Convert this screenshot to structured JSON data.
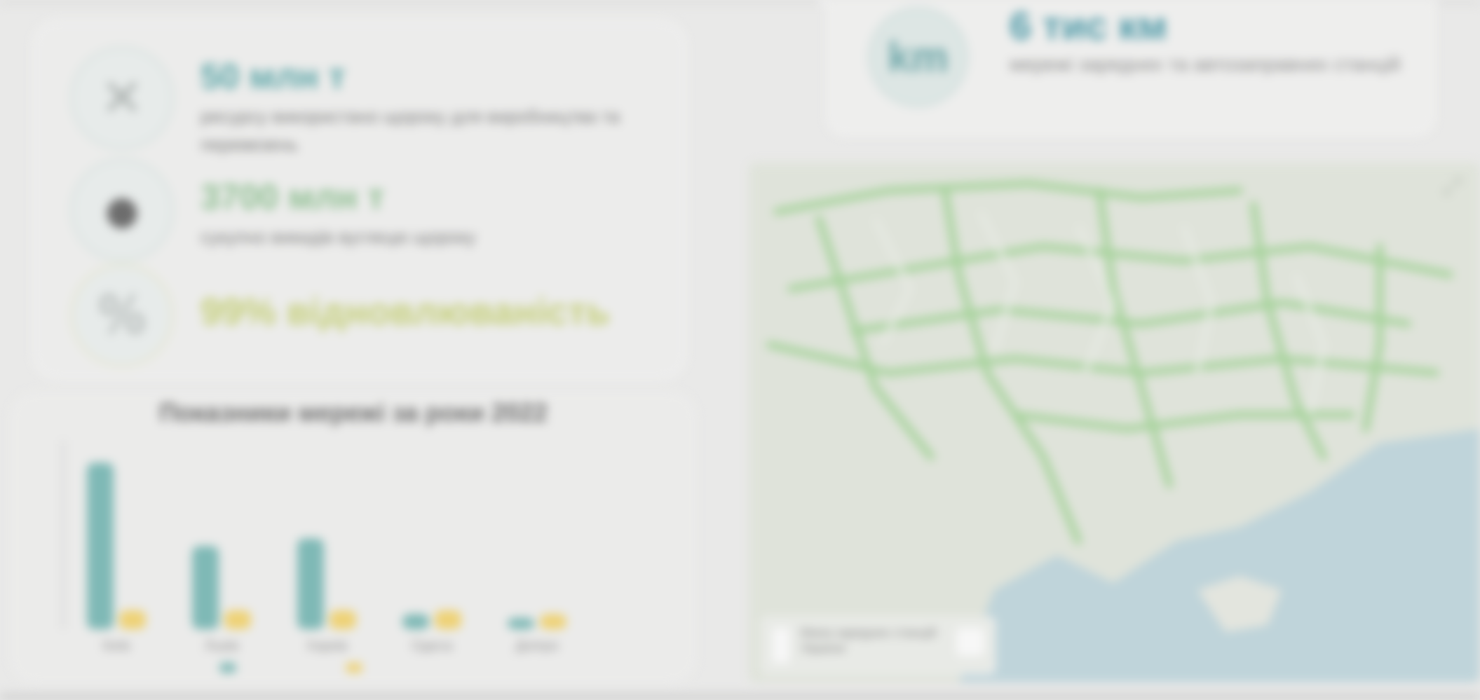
{
  "stats": [
    {
      "icon": "no-charging-icon",
      "glyph": "✕",
      "value": "50 млн т",
      "description": "ресурсу використано щороку для виробництва та перевезень"
    },
    {
      "icon": "dot-icon",
      "glyph": "●",
      "value": "3700 млн т",
      "description": "сукупно викидів вуглецю щороку"
    },
    {
      "icon": "pricing-icon",
      "glyph": "%",
      "value": "99% відновлюваність",
      "description": ""
    }
  ],
  "network": {
    "icon_label": "km",
    "title": "6 тис км",
    "description": "мережі зарядних та автозаправних станцій"
  },
  "chart_data": {
    "type": "bar",
    "title": "Показники мережі за роки 2022",
    "categories": [
      "Київ",
      "Львів",
      "Харків",
      "Одеса",
      "Дніпро"
    ],
    "series": [
      {
        "name": "",
        "color": "#7fb9b6",
        "values": [
          88,
          44,
          48,
          8,
          6
        ]
      },
      {
        "name": "",
        "color": "#eed276",
        "values": [
          10,
          10,
          10,
          10,
          8
        ]
      }
    ],
    "ylim": [
      0,
      100
    ],
    "legend": [
      "",
      ""
    ],
    "legend_position": "bottom"
  },
  "map": {
    "legend_text": "Мапа зарядних станцій України",
    "corner_icon": "expand-icon",
    "corner_glyph": "⤢",
    "land_color": "#dfe3da",
    "sea_color": "#bfd4da",
    "road_color": "#a6d39b"
  }
}
